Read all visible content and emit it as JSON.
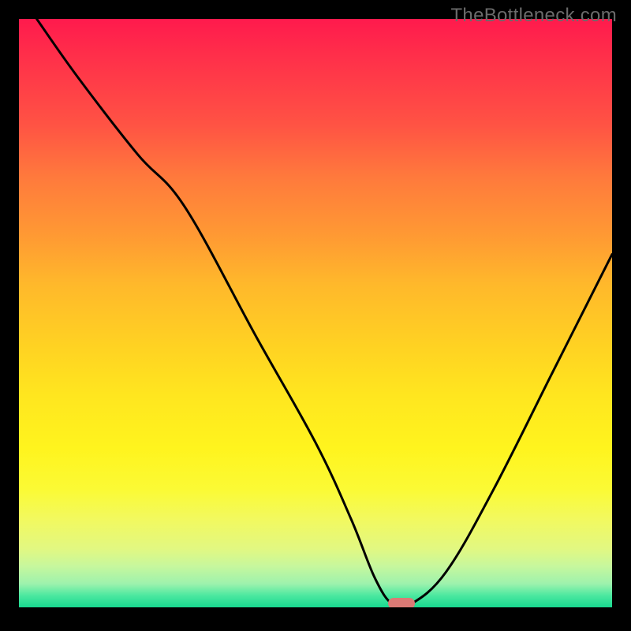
{
  "watermark": "TheBottleneck.com",
  "colors": {
    "top": "#ff1a4d",
    "mid": "#ffd322",
    "bottom": "#18d88f",
    "curve": "#000000",
    "marker": "#db7a75",
    "frame": "#000000"
  },
  "chart_data": {
    "type": "line",
    "title": "",
    "xlabel": "",
    "ylabel": "",
    "xlim": [
      0,
      100
    ],
    "ylim": [
      0,
      100
    ],
    "series": [
      {
        "name": "bottleneck-curve",
        "x": [
          3,
          10,
          20,
          28,
          40,
          50,
          56,
          60,
          63,
          66,
          72,
          80,
          90,
          100
        ],
        "y": [
          100,
          90,
          77,
          68,
          46,
          28,
          15,
          5,
          0.5,
          0.5,
          6,
          20,
          40,
          60
        ]
      }
    ],
    "marker": {
      "x": 64.5,
      "y": 0.7
    },
    "annotations": [],
    "legend": false,
    "grid": false
  }
}
